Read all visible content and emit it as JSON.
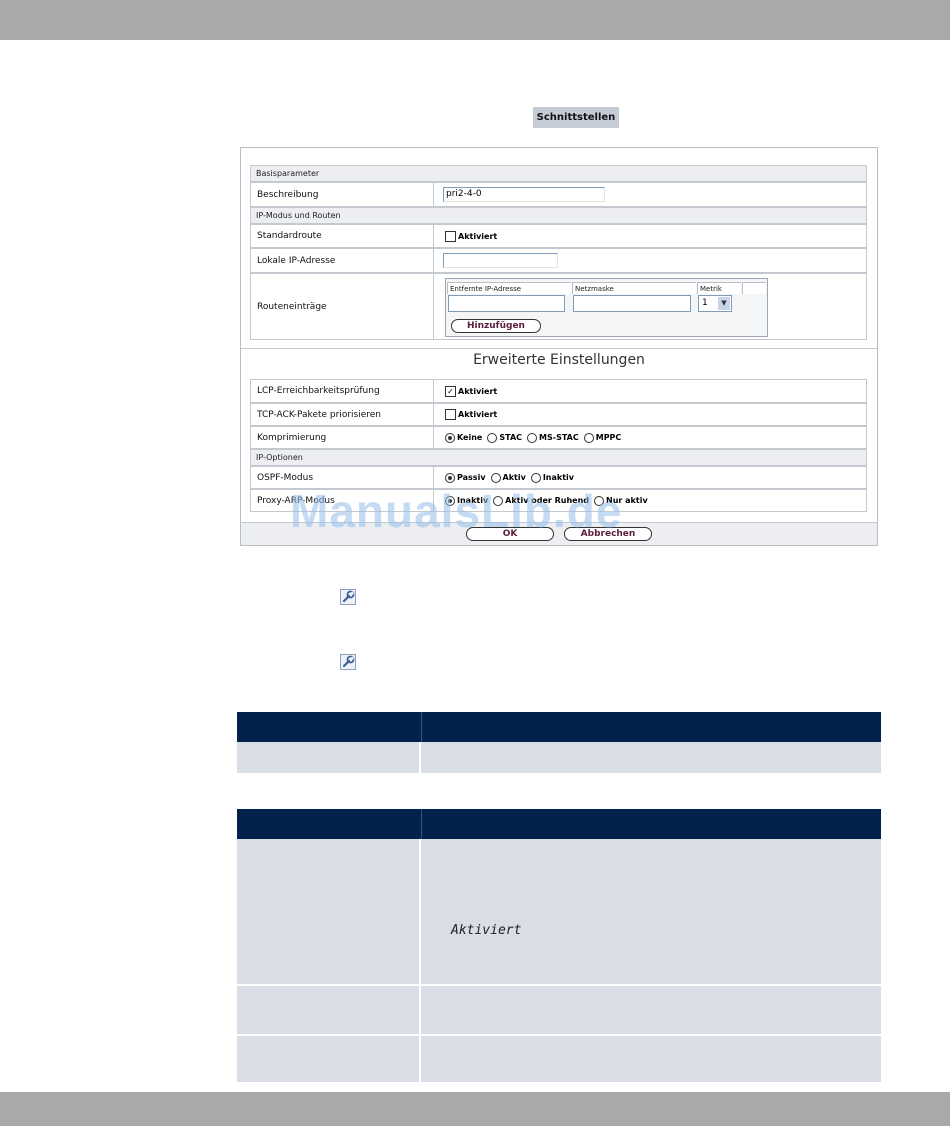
{
  "page_title": "Schnittstellen",
  "basic": {
    "section_label": "Basisparameter",
    "description_label": "Beschreibung",
    "description_value": "pri2-4-0"
  },
  "ip_routing": {
    "section_label": "IP-Modus und Routen",
    "default_route_label": "Standardroute",
    "default_route_option": "Aktiviert",
    "local_ip_label": "Lokale IP-Adresse",
    "local_ip_value": "",
    "route_entries_label": "Routeneinträge",
    "route_table": {
      "col_remote_ip": "Entfernte IP-Adresse",
      "col_netmask": "Netzmaske",
      "col_metric": "Metrik",
      "metric_value": "1",
      "add_button": "Hinzufügen"
    }
  },
  "advanced": {
    "title": "Erweiterte Einstellungen",
    "lcp_label": "LCP-Erreichbarkeitsprüfung",
    "lcp_option": "Aktiviert",
    "tcp_ack_label": "TCP-ACK-Pakete priorisieren",
    "tcp_ack_option": "Aktiviert",
    "compression_label": "Komprimierung",
    "compression_options": [
      "Keine",
      "STAC",
      "MS-STAC",
      "MPPC"
    ],
    "ip_options_label": "IP-Optionen",
    "ospf_label": "OSPF-Modus",
    "ospf_options": [
      "Passiv",
      "Aktiv",
      "Inaktiv"
    ],
    "proxy_arp_label": "Proxy-ARP-Modus",
    "proxy_arp_options": [
      "Inaktiv",
      "Aktiv oder Ruhend",
      "Nur aktiv"
    ]
  },
  "footer": {
    "ok_button": "OK",
    "cancel_button": "Abbrechen"
  },
  "watermark": "ManualsLib.de",
  "desc_table": {
    "value_text": "Aktiviert"
  }
}
